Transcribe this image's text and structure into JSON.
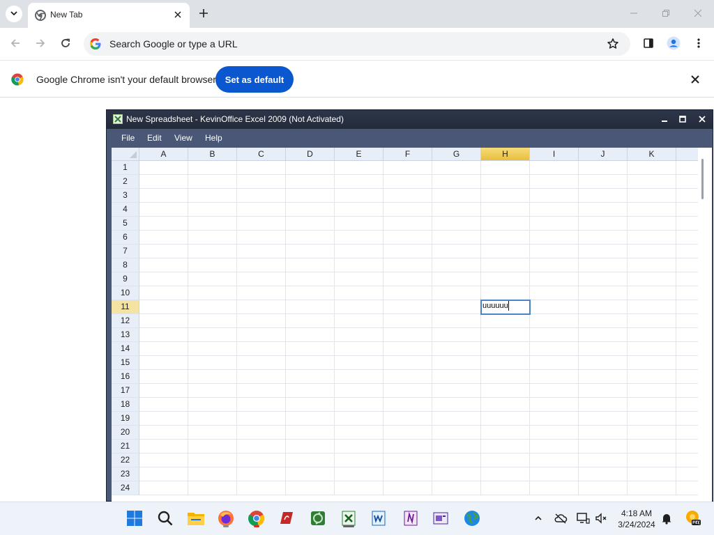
{
  "browser": {
    "tab_title": "New Tab",
    "omnibox_placeholder": "Search Google or type a URL",
    "infobar_text": "Google Chrome isn't your default browser",
    "set_default_label": "Set as default"
  },
  "excel": {
    "window_title": "New Spreadsheet - KevinOffice Excel 2009 (Not Activated)",
    "menu": [
      "File",
      "Edit",
      "View",
      "Help"
    ],
    "columns": [
      "A",
      "B",
      "C",
      "D",
      "E",
      "F",
      "G",
      "H",
      "I",
      "J",
      "K"
    ],
    "rows": [
      "1",
      "2",
      "3",
      "4",
      "5",
      "6",
      "7",
      "8",
      "9",
      "10",
      "11",
      "12",
      "13",
      "14",
      "15",
      "16",
      "17",
      "18",
      "19",
      "20",
      "21",
      "22",
      "23",
      "24"
    ],
    "selected_column": "H",
    "selected_row": "11",
    "active_cell_value": "uuuuuu"
  },
  "taskbar": {
    "time": "4:18 AM",
    "date": "3/24/2024"
  },
  "colors": {
    "chrome_blue": "#0b57d0",
    "xl_titlebar": "#2d3649",
    "xl_frame": "#4b5777",
    "selected_header": "#e9be3d",
    "active_cell_border": "#4a83c8"
  }
}
